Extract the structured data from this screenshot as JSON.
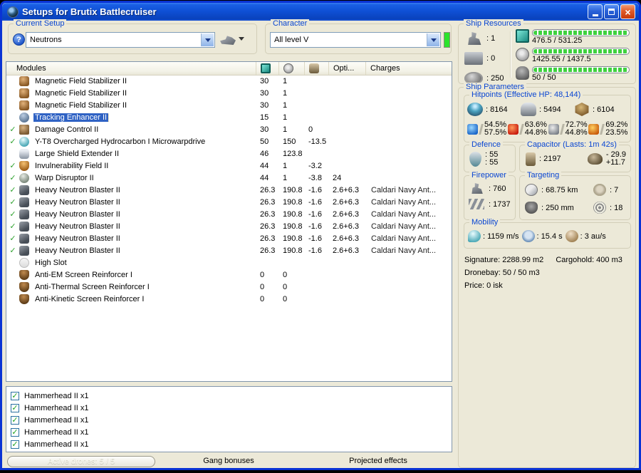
{
  "colors": {
    "window_border": "#0a33d4",
    "titlebar_blue": "#0f50d6",
    "panel_beige": "#ece9d8",
    "selection_blue": "#2f62c4",
    "groupbox_label_blue": "#0a46d2",
    "progress_green": "#3fd13f",
    "skill_indicator_green": "#2ce32c",
    "check_green": "#2fa32f"
  },
  "window": {
    "title": "Setups for Brutix Battlecruiser"
  },
  "toolbar": {
    "current_setup": {
      "label": "Current Setup",
      "value": "Neutrons"
    },
    "character": {
      "label": "Character",
      "value": "All level V"
    }
  },
  "modules_panel": {
    "header": {
      "label": "Modules",
      "icon_cols": [
        {
          "icon": "cpu"
        },
        {
          "icon": "powergrid"
        },
        {
          "icon": "capacitor-battery"
        }
      ],
      "opti": "Opti...",
      "charges": "Charges"
    },
    "rows": [
      {
        "check": "",
        "icon": "magstab",
        "name": "Magnetic Field Stabilizer II",
        "cpu": "30",
        "pg": "1",
        "cap": "",
        "opti": "",
        "charge": "",
        "selected": false
      },
      {
        "check": "",
        "icon": "magstab",
        "name": "Magnetic Field Stabilizer II",
        "cpu": "30",
        "pg": "1",
        "cap": "",
        "opti": "",
        "charge": "",
        "selected": false
      },
      {
        "check": "",
        "icon": "magstab",
        "name": "Magnetic Field Stabilizer II",
        "cpu": "30",
        "pg": "1",
        "cap": "",
        "opti": "",
        "charge": "",
        "selected": false
      },
      {
        "check": "",
        "icon": "tracking",
        "name": "Tracking Enhancer II",
        "cpu": "15",
        "pg": "1",
        "cap": "",
        "opti": "",
        "charge": "",
        "selected": true
      },
      {
        "check": "✓",
        "icon": "damage-control",
        "name": "Damage Control II",
        "cpu": "30",
        "pg": "1",
        "cap": "0",
        "opti": "",
        "charge": "",
        "selected": false
      },
      {
        "check": "✓",
        "icon": "mwd",
        "name": "Y-T8 Overcharged Hydrocarbon I Microwarpdrive",
        "cpu": "50",
        "pg": "150",
        "cap": "-13.5",
        "opti": "",
        "charge": "",
        "selected": false
      },
      {
        "check": "",
        "icon": "shield-extender",
        "name": "Large Shield Extender II",
        "cpu": "46",
        "pg": "123.8",
        "cap": "",
        "opti": "",
        "charge": "",
        "selected": false
      },
      {
        "check": "✓",
        "icon": "invuln",
        "name": "Invulnerability Field II",
        "cpu": "44",
        "pg": "1",
        "cap": "-3.2",
        "opti": "",
        "charge": "",
        "selected": false
      },
      {
        "check": "✓",
        "icon": "warp-disruptor",
        "name": "Warp Disruptor II",
        "cpu": "44",
        "pg": "1",
        "cap": "-3.8",
        "opti": "24",
        "charge": "",
        "selected": false
      },
      {
        "check": "✓",
        "icon": "blaster",
        "name": "Heavy Neutron Blaster II",
        "cpu": "26.3",
        "pg": "190.8",
        "cap": "-1.6",
        "opti": "2.6+6.3",
        "charge": "Caldari Navy Ant...",
        "selected": false
      },
      {
        "check": "✓",
        "icon": "blaster",
        "name": "Heavy Neutron Blaster II",
        "cpu": "26.3",
        "pg": "190.8",
        "cap": "-1.6",
        "opti": "2.6+6.3",
        "charge": "Caldari Navy Ant...",
        "selected": false
      },
      {
        "check": "✓",
        "icon": "blaster",
        "name": "Heavy Neutron Blaster II",
        "cpu": "26.3",
        "pg": "190.8",
        "cap": "-1.6",
        "opti": "2.6+6.3",
        "charge": "Caldari Navy Ant...",
        "selected": false
      },
      {
        "check": "✓",
        "icon": "blaster",
        "name": "Heavy Neutron Blaster II",
        "cpu": "26.3",
        "pg": "190.8",
        "cap": "-1.6",
        "opti": "2.6+6.3",
        "charge": "Caldari Navy Ant...",
        "selected": false
      },
      {
        "check": "✓",
        "icon": "blaster",
        "name": "Heavy Neutron Blaster II",
        "cpu": "26.3",
        "pg": "190.8",
        "cap": "-1.6",
        "opti": "2.6+6.3",
        "charge": "Caldari Navy Ant...",
        "selected": false
      },
      {
        "check": "✓",
        "icon": "blaster",
        "name": "Heavy Neutron Blaster II",
        "cpu": "26.3",
        "pg": "190.8",
        "cap": "-1.6",
        "opti": "2.6+6.3",
        "charge": "Caldari Navy Ant...",
        "selected": false
      },
      {
        "check": "",
        "icon": "empty-high",
        "name": "High Slot",
        "cpu": "",
        "pg": "",
        "cap": "",
        "opti": "",
        "charge": "",
        "selected": false
      },
      {
        "check": "",
        "icon": "rig",
        "name": "Anti-EM Screen Reinforcer I",
        "cpu": "0",
        "pg": "0",
        "cap": "",
        "opti": "",
        "charge": "",
        "selected": false
      },
      {
        "check": "",
        "icon": "rig",
        "name": "Anti-Thermal Screen Reinforcer I",
        "cpu": "0",
        "pg": "0",
        "cap": "",
        "opti": "",
        "charge": "",
        "selected": false
      },
      {
        "check": "",
        "icon": "rig",
        "name": "Anti-Kinetic Screen Reinforcer I",
        "cpu": "0",
        "pg": "0",
        "cap": "",
        "opti": "",
        "charge": "",
        "selected": false
      }
    ]
  },
  "drones_panel": {
    "rows": [
      {
        "check": "✓",
        "label": "Hammerhead II x1"
      },
      {
        "check": "✓",
        "label": "Hammerhead II x1"
      },
      {
        "check": "✓",
        "label": "Hammerhead II x1"
      },
      {
        "check": "✓",
        "label": "Hammerhead II x1"
      },
      {
        "check": "✓",
        "label": "Hammerhead II x1"
      }
    ]
  },
  "bottom_bar": {
    "active_drones": "Active drones: 5 / 5",
    "gang_bonuses": "Gang bonuses",
    "projected_effects": "Projected effects"
  },
  "ship_resources": {
    "label": "Ship Resources",
    "hardpoints": [
      {
        "icon": "turret-hardpoint",
        "value": ": 1"
      },
      {
        "icon": "launcher-hardpoint",
        "value": ": 0"
      },
      {
        "icon": "rig-calibration",
        "value": ": 250"
      }
    ],
    "bars": [
      {
        "icon": "cpu",
        "text": "476.5 / 531.25"
      },
      {
        "icon": "powergrid",
        "text": "1425.55 / 1437.5"
      },
      {
        "icon": "drone-bandwidth",
        "text": "50 / 50"
      }
    ]
  },
  "ship_parameters": {
    "label": "Ship Parameters",
    "hitpoints": {
      "label": "Hitpoints (Effective HP: 48,144)",
      "pools": [
        {
          "icon": "shield",
          "value": ": 8164"
        },
        {
          "icon": "armor",
          "value": ": 5494"
        },
        {
          "icon": "structure",
          "value": ": 6104"
        }
      ],
      "resists": [
        {
          "icon": "em",
          "top": "54.5%",
          "bottom": "57.5%"
        },
        {
          "icon": "thermal",
          "top": "63.6%",
          "bottom": "44.8%"
        },
        {
          "icon": "kinetic",
          "top": "72.7%",
          "bottom": "44.8%"
        },
        {
          "icon": "explosive",
          "top": "69.2%",
          "bottom": "23.5%"
        }
      ]
    },
    "defence": {
      "label": "Defence",
      "icon": "defence-shield",
      "top": ": 55",
      "bottom": ": 55"
    },
    "capacitor": {
      "label": "Capacitor (Lasts: 1m 42s)",
      "amount": ": 2197",
      "out": "- 29.9",
      "in": "+11.7"
    },
    "firepower": {
      "label": "Firepower",
      "rows": [
        {
          "icon": "turret-dps",
          "value": ": 760"
        },
        {
          "icon": "volley",
          "value": ": 1737"
        }
      ]
    },
    "targeting": {
      "label": "Targeting",
      "cells": [
        {
          "icon": "targeting-range",
          "value": ": 68.75 km"
        },
        {
          "icon": "max-targets",
          "value": ": 7"
        },
        {
          "icon": "scan-resolution",
          "value": ": 250 mm"
        },
        {
          "icon": "sensor-strength",
          "value": ": 18"
        }
      ]
    },
    "mobility": {
      "label": "Mobility",
      "cells": [
        {
          "icon": "speed",
          "value": ": 1159 m/s"
        },
        {
          "icon": "align-time",
          "value": ": 15.4 s"
        },
        {
          "icon": "warp-speed",
          "value": ": 3 au/s"
        }
      ]
    },
    "stats": {
      "signature": "Signature: 2288.99 m2",
      "cargohold": "Cargohold: 400 m3",
      "dronebay": "Dronebay: 50 / 50 m3",
      "price": "Price: 0 isk"
    }
  }
}
